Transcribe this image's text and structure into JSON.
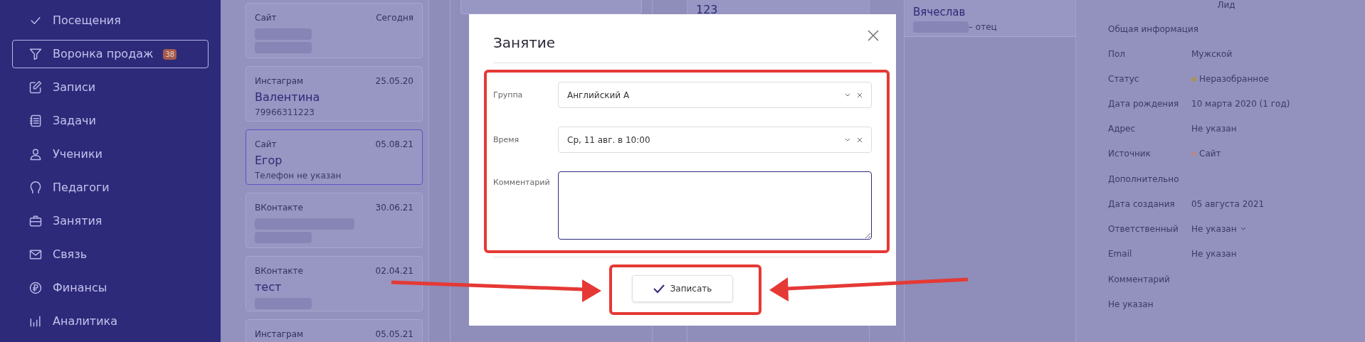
{
  "sidebar": {
    "items": [
      {
        "label": "Посещения",
        "selected": false
      },
      {
        "label": "Воронка продаж",
        "selected": true,
        "badge": "38"
      },
      {
        "label": "Записи",
        "selected": false
      },
      {
        "label": "Задачи",
        "selected": false
      },
      {
        "label": "Ученики",
        "selected": false
      },
      {
        "label": "Педагоги",
        "selected": false
      },
      {
        "label": "Занятия",
        "selected": false
      },
      {
        "label": "Связь",
        "selected": false
      },
      {
        "label": "Финансы",
        "selected": false
      },
      {
        "label": "Аналитика",
        "selected": false
      }
    ]
  },
  "leads": [
    {
      "source": "Сайт",
      "date": "Сегодня",
      "selected": false
    },
    {
      "source": "Инстаграм",
      "date": "25.05.20",
      "name": "Валентина",
      "phone": "79966311223",
      "selected": false
    },
    {
      "source": "Сайт",
      "date": "05.08.21",
      "name": "Егор",
      "phone": "Телефон не указан",
      "selected": true
    },
    {
      "source": "ВКонтакте",
      "date": "30.06.21",
      "selected": false
    },
    {
      "source": "ВКонтакте",
      "date": "02.04.21",
      "name": "тест",
      "selected": false
    },
    {
      "source": "Инстаграм",
      "date": "05.05.21",
      "selected": false
    }
  ],
  "middle": {
    "card_text": "123",
    "contact": {
      "name": "Вячеслав",
      "relation": "– отец"
    }
  },
  "details": {
    "title": "Лид",
    "sections": [
      {
        "heading": "Общая информация",
        "rows": [
          {
            "label": "Пол",
            "value": "Мужской"
          },
          {
            "label": "Статус",
            "value": "Неразобранное",
            "color": "#a8935a"
          },
          {
            "label": "Дата рождения",
            "value": "10 марта 2020 (1 год)"
          },
          {
            "label": "Адрес",
            "value": "Не указан"
          },
          {
            "label": "Источник",
            "value": "Сайт",
            "color": "#b38a8e"
          }
        ]
      },
      {
        "heading": "Дополнительно",
        "rows": [
          {
            "label": "Дата создания",
            "value": "05 августа 2021"
          },
          {
            "label": "Ответственный",
            "value": "Не указан",
            "dropdown": true
          },
          {
            "label": "Email",
            "value": "Не указан"
          }
        ]
      },
      {
        "heading": "Комментарий",
        "rows": [
          {
            "value": "Не указан"
          }
        ]
      }
    ]
  },
  "modal": {
    "title": "Занятие",
    "fields": [
      {
        "label": "Группа",
        "kind": "select",
        "value": "Английский А"
      },
      {
        "label": "Время",
        "kind": "select",
        "value": "Ср, 11 авг. в 10:00"
      },
      {
        "label": "Комментарий",
        "kind": "textarea"
      }
    ],
    "button": "Записать"
  }
}
